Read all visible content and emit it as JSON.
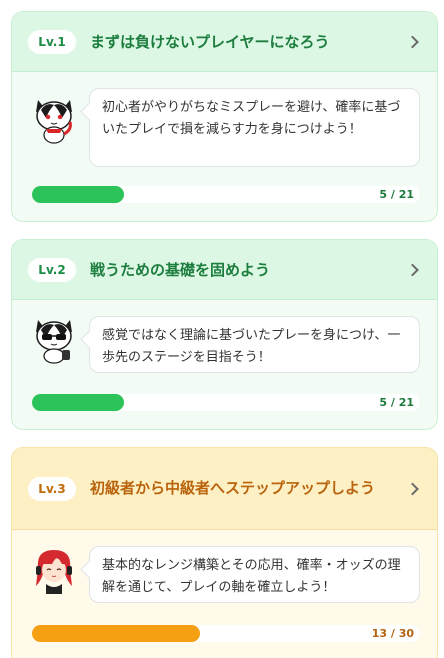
{
  "levels": [
    {
      "level_label": "Lv.1",
      "title": "まずは負けないプレイヤーになろう",
      "description": "初心者がやりがちなミスプレーを避け、確率に基づいたプレイで損を減らす力を身につけよう！",
      "progress_text": "5 / 21",
      "progress_current": 5,
      "progress_total": 21,
      "theme": "green",
      "avatar_icon": "cat-mascot-icon"
    },
    {
      "level_label": "Lv.2",
      "title": "戦うための基礎を固めよう",
      "description": "感覚ではなく理論に基づいたプレーを身につけ、一歩先のステージを目指そう！",
      "progress_text": "5 / 21",
      "progress_current": 5,
      "progress_total": 21,
      "theme": "green",
      "avatar_icon": "cat-mascot-sunglasses-icon"
    },
    {
      "level_label": "Lv.3",
      "title": "初級者から中級者へステップアップしよう",
      "description": "基本的なレンジ構築とその応用、確率・オッズの理解を通じて、プレイの軸を確立しよう！",
      "progress_text": "13 / 30",
      "progress_current": 13,
      "progress_total": 30,
      "theme": "orange",
      "avatar_icon": "red-hair-girl-icon"
    }
  ],
  "colors": {
    "green_accent": "#2cc45a",
    "orange_accent": "#f4a012"
  }
}
